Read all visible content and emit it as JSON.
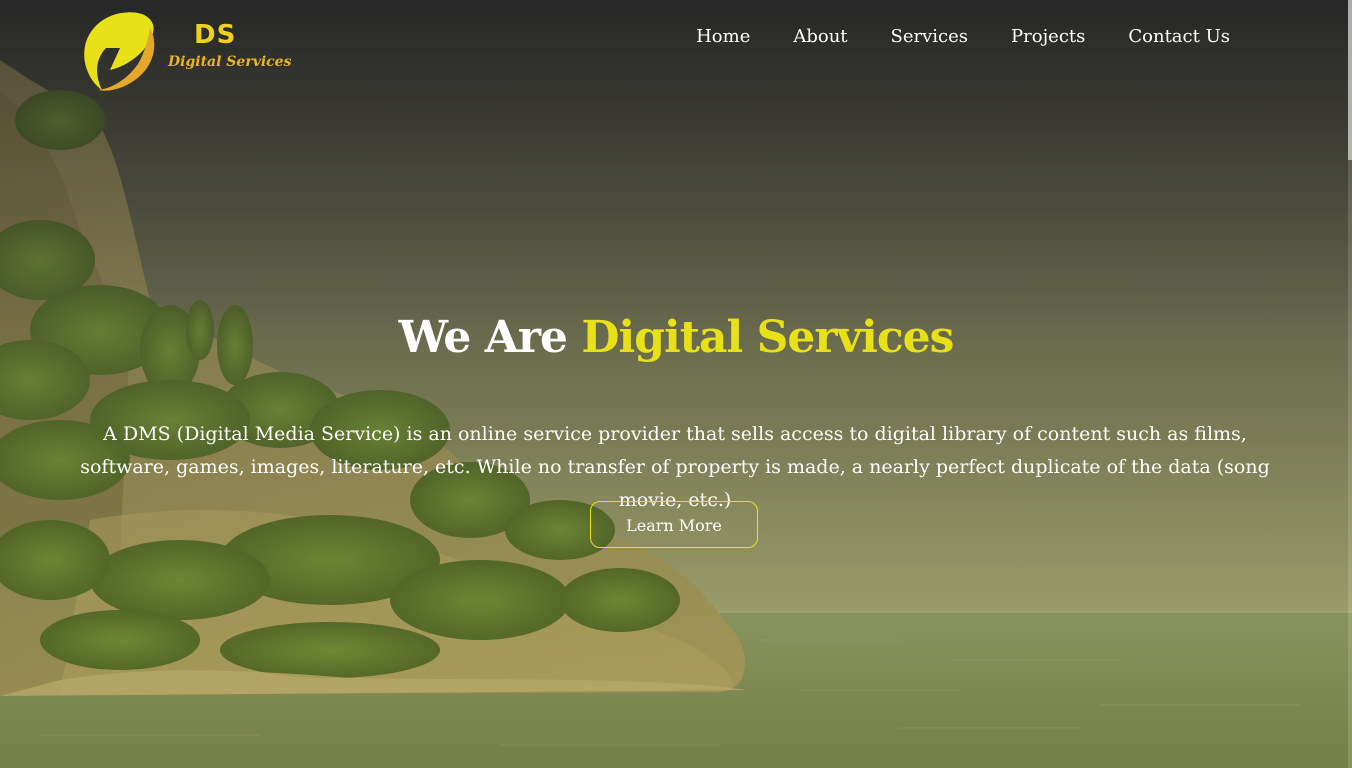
{
  "brand": {
    "logo_text": "DS",
    "tagline": "Digital Services"
  },
  "nav": {
    "items": [
      "Home",
      "About",
      "Services",
      "Projects",
      "Contact Us"
    ]
  },
  "hero": {
    "title_part1": "We Are",
    "title_part2": "Digital Services",
    "description": "A DMS (Digital Media Service) is an online service provider that sells access to digital library of content such as films, software, games, images, literature, etc. While no transfer of property is made, a nearly perfect duplicate of the data (song movie, etc.)",
    "cta_label": "Learn More"
  },
  "colors": {
    "accent_yellow": "#e9e118",
    "logo_orange": "#e8b52a",
    "text_white": "#ffffff"
  },
  "icons": {
    "logo_mark": "lightning-bolt-circle-icon"
  }
}
